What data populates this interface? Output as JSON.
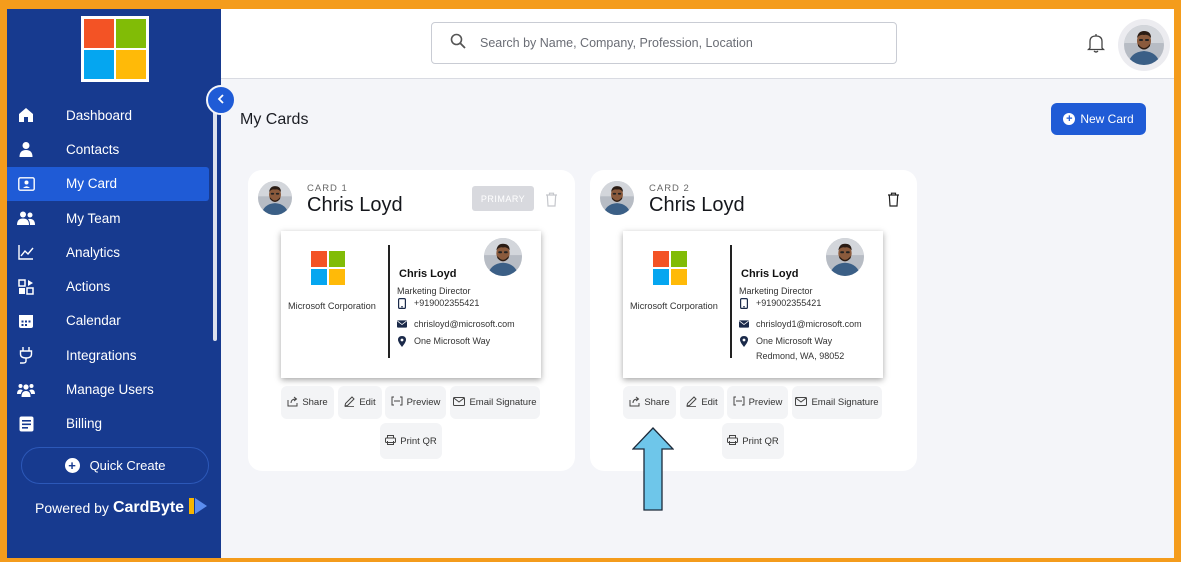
{
  "colors": {
    "sidebar_bg": "#173a8f",
    "accent": "#1f5bd6",
    "frame_border": "#f49c1c",
    "arrow": "#6ec6ea"
  },
  "sidebar": {
    "items": [
      {
        "label": "Dashboard",
        "icon": "home-icon"
      },
      {
        "label": "Contacts",
        "icon": "person-icon"
      },
      {
        "label": "My Card",
        "icon": "id-card-icon",
        "active": true
      },
      {
        "label": "My Team",
        "icon": "team-icon"
      },
      {
        "label": "Analytics",
        "icon": "chart-icon"
      },
      {
        "label": "Actions",
        "icon": "actions-icon"
      },
      {
        "label": "Calendar",
        "icon": "calendar-icon"
      },
      {
        "label": "Integrations",
        "icon": "plug-icon"
      },
      {
        "label": "Manage Users",
        "icon": "users-icon"
      },
      {
        "label": "Billing",
        "icon": "billing-icon"
      }
    ],
    "quick_create": "Quick Create",
    "powered_by": "Powered by",
    "brand": "CardByte"
  },
  "header": {
    "search_placeholder": "Search by Name, Company, Profession, Location"
  },
  "page": {
    "title": "My Cards",
    "new_card": "New Card"
  },
  "cards": [
    {
      "label": "CARD 1",
      "name": "Chris Loyd",
      "primary": "PRIMARY",
      "company": "Microsoft Corporation",
      "person": "Chris Loyd",
      "title": "Marketing Director",
      "phone": "+919002355421",
      "email": "chrisloyd@microsoft.com",
      "address1": "One Microsoft Way",
      "address2": ""
    },
    {
      "label": "CARD 2",
      "name": "Chris Loyd",
      "company": "Microsoft Corporation",
      "person": "Chris Loyd",
      "title": "Marketing Director",
      "phone": "+919002355421",
      "email": "chrisloyd1@microsoft.com",
      "address1": "One Microsoft Way",
      "address2": "Redmond, WA, 98052"
    }
  ],
  "actions": {
    "share": "Share",
    "edit": "Edit",
    "preview": "Preview",
    "email_signature": "Email Signature",
    "print_qr": "Print QR"
  }
}
